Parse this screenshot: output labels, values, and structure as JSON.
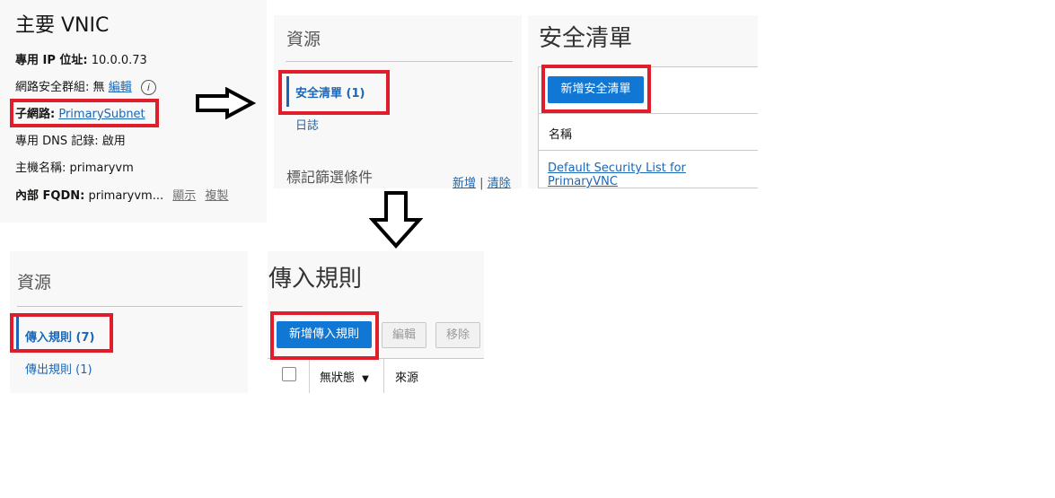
{
  "vnic": {
    "title": "主要 VNIC",
    "private_ip_label": "專用 IP 位址:",
    "private_ip_value": "10.0.0.73",
    "nsg_label": "網路安全群組:",
    "nsg_value": "無",
    "nsg_edit": "編輯",
    "subnet_label": "子網路:",
    "subnet_value": "PrimarySubnet",
    "dns_label": "專用 DNS 記錄:",
    "dns_value": "啟用",
    "hostname_label": "主機名稱:",
    "hostname_value": "primaryvm",
    "fqdn_label": "內部 FQDN:",
    "fqdn_value": "primaryvm...",
    "fqdn_show": "顯示",
    "fqdn_copy": "複製"
  },
  "resources_top": {
    "title": "資源",
    "nav_security_lists": "安全清單 (1)",
    "nav_logs": "日誌",
    "tag_filters": "標記篩選條件",
    "add_link": "新增",
    "separator": "|",
    "clear_link": "清除"
  },
  "security_lists": {
    "title": "安全清單",
    "create_button": "新增安全清單",
    "column_name": "名稱",
    "item": "Default Security List for PrimaryVNC"
  },
  "resources_bottom": {
    "title": "資源",
    "nav_ingress": "傳入規則 (7)",
    "nav_egress": "傳出規則 (1)"
  },
  "ingress_rules": {
    "title": "傳入規則",
    "add_button": "新增傳入規則",
    "edit_button": "編輯",
    "remove_button": "移除",
    "column_stateless": "無狀態",
    "column_source": "來源"
  },
  "colors": {
    "highlight": "#e01e2b",
    "primary_button": "#1177d4",
    "link": "#1b67b5"
  }
}
